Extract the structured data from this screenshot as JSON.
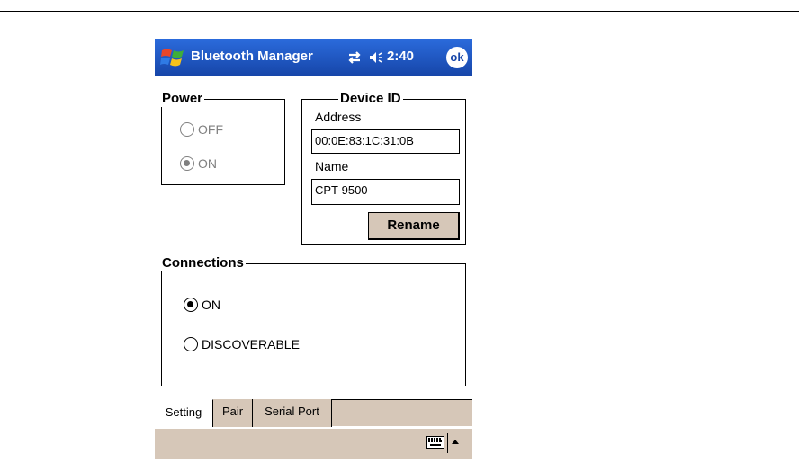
{
  "titlebar": {
    "title": "Bluetooth Manager",
    "clock": "2:40",
    "ok_label": "ok"
  },
  "power": {
    "legend": "Power",
    "options": [
      {
        "label": "OFF",
        "selected": false
      },
      {
        "label": "ON",
        "selected": true
      }
    ]
  },
  "device_id": {
    "legend": "Device ID",
    "address_label": "Address",
    "address_value": "00:0E:83:1C:31:0B",
    "name_label": "Name",
    "name_value": "CPT-9500",
    "rename_label": "Rename"
  },
  "connections": {
    "legend": "Connections",
    "options": [
      {
        "label": "ON",
        "selected": true
      },
      {
        "label": "DISCOVERABLE",
        "selected": false
      }
    ]
  },
  "tabs": [
    {
      "label": "Setting",
      "active": true
    },
    {
      "label": "Pair",
      "active": false
    },
    {
      "label": "Serial Port",
      "active": false
    }
  ],
  "colors": {
    "titlebar": "#1a4fb8",
    "chrome": "#d6c7b8"
  }
}
